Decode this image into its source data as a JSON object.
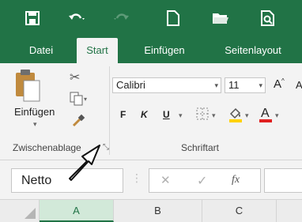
{
  "ribbon_tabs": {
    "file": "Datei",
    "home": "Start",
    "insert": "Einfügen",
    "page_layout": "Seitenlayout"
  },
  "clipboard": {
    "paste_label": "Einfügen",
    "group_label": "Zwischenablage"
  },
  "font": {
    "name": "Calibri",
    "size": "11",
    "group_label": "Schriftart",
    "bold": "F",
    "italic": "K",
    "underline": "U",
    "grow": "A"
  },
  "formula_bar": {
    "name_box_value": "Netto",
    "cancel": "✕",
    "enter": "✓",
    "fx": "fx"
  },
  "columns": [
    "A",
    "B",
    "C"
  ],
  "colors": {
    "brand": "#217346",
    "fill_yellow": "#ffd200",
    "font_red": "#e02020"
  }
}
